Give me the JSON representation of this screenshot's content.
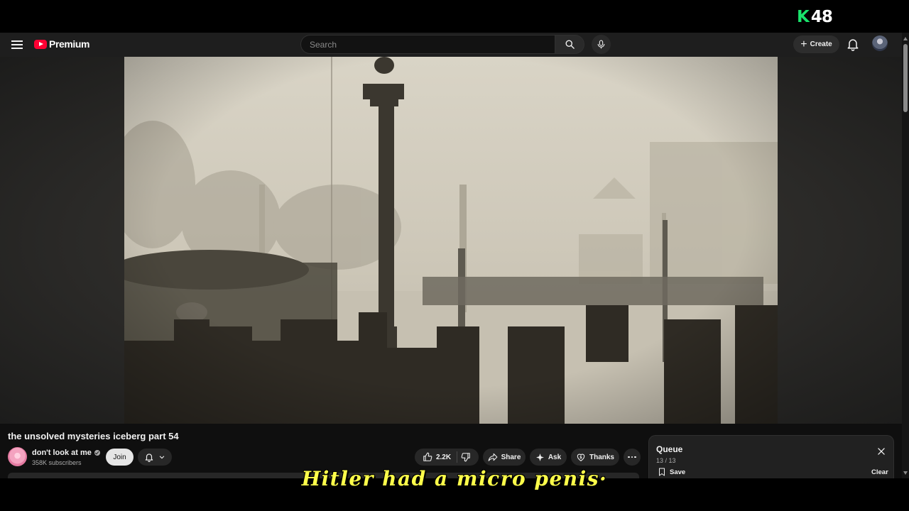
{
  "overlay": {
    "logo_letter": "K",
    "logo_number": "48",
    "logo_letter_color": "#19e36b",
    "subtitle": "Hitler had a micro penis·"
  },
  "masthead": {
    "menu_icon": "hamburger-icon",
    "brand_label": "Premium",
    "brand_color": "#ff0033",
    "search_placeholder": "Search",
    "search_icon": "search-icon",
    "mic_icon": "mic-icon",
    "create_label": "Create",
    "notifications_icon": "bell-icon"
  },
  "video": {
    "title": "the unsolved mysteries iceberg part 54",
    "channel_name": "don't look at me",
    "subscribers": "358K subscribers",
    "join_label": "Join",
    "like_count": "2.2K",
    "share_label": "Share",
    "ask_label": "Ask",
    "thanks_label": "Thanks"
  },
  "queue": {
    "title": "Queue",
    "count": "13 / 13",
    "save_label": "Save",
    "clear_label": "Clear"
  }
}
